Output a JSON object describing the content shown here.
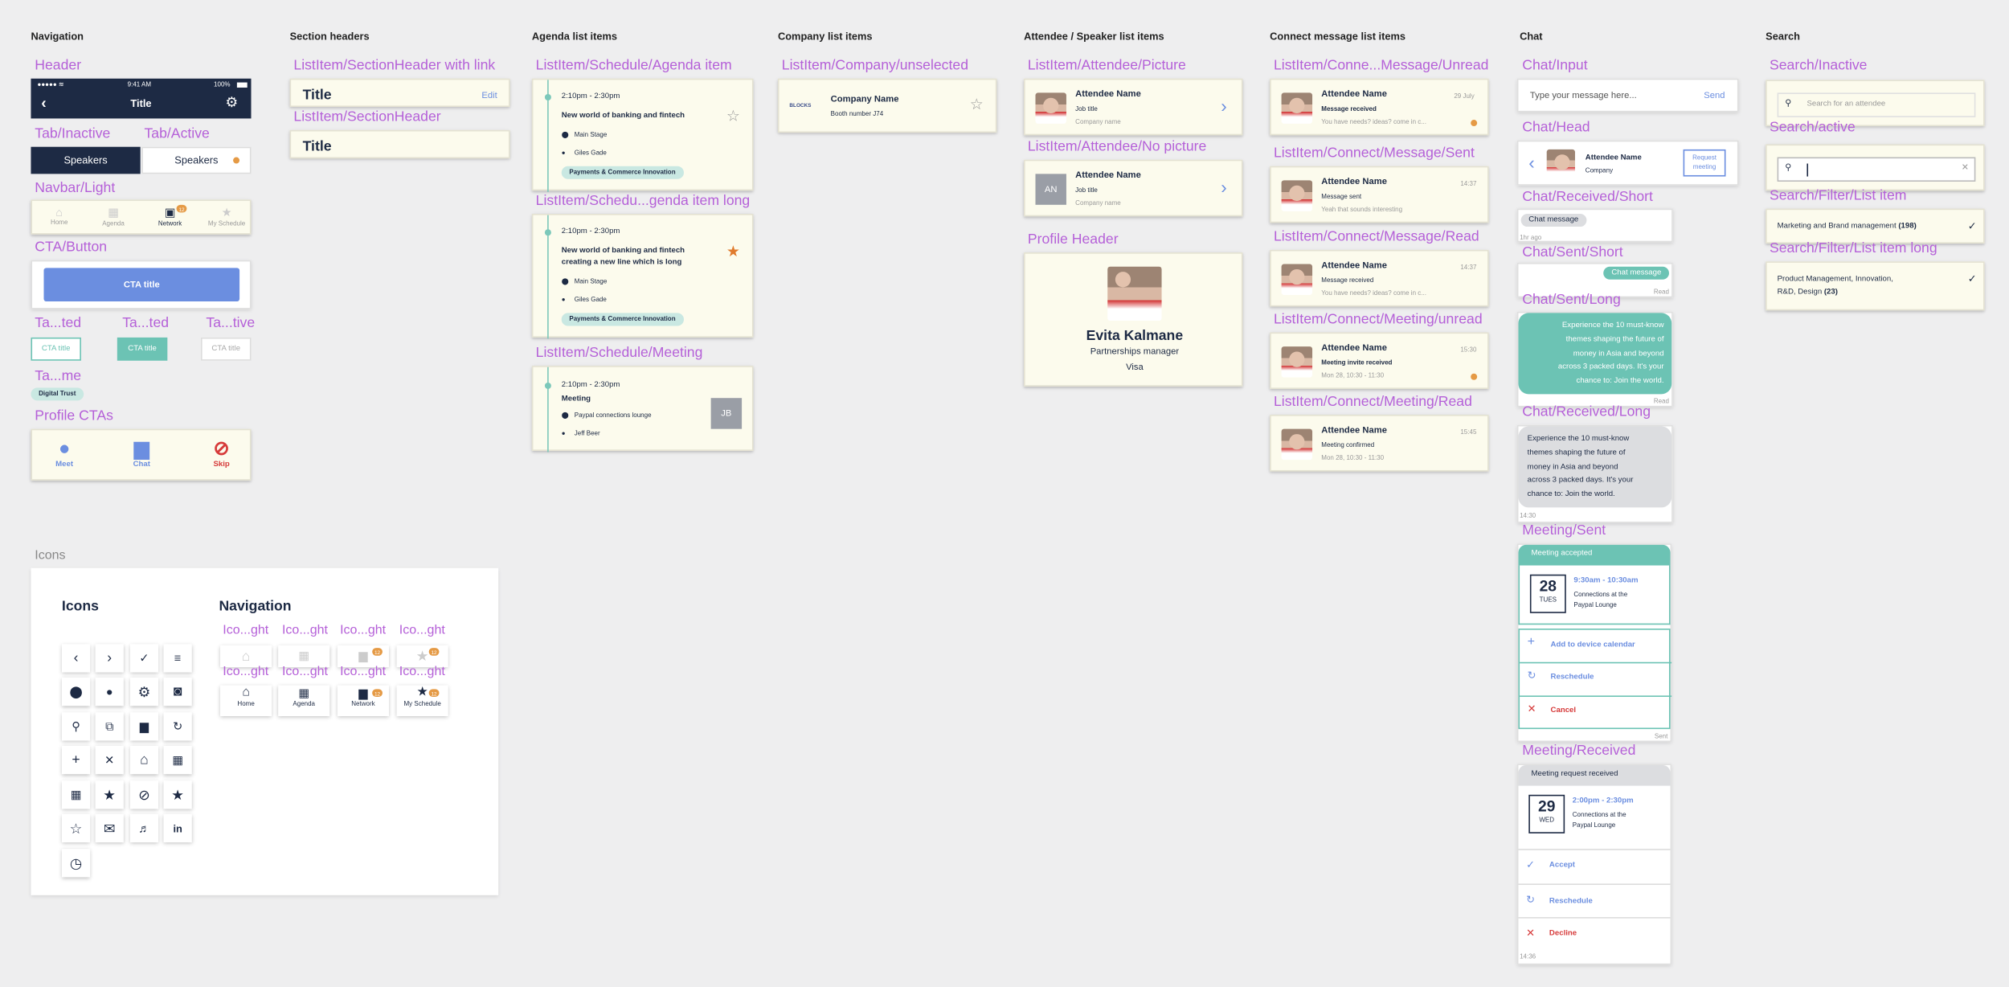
{
  "cols": {
    "navigation": "Navigation",
    "section_headers": "Section headers",
    "agenda": "Agenda list items",
    "company": "Company list items",
    "attendee": "Attendee / Speaker list items",
    "connect": "Connect message list items",
    "chat": "Chat",
    "search": "Search",
    "icons": "Icons"
  },
  "labels": {
    "header": "Header",
    "tab_inactive": "Tab/Inactive",
    "tab_active": "Tab/Active",
    "navbar": "Navbar/Light",
    "cta": "CTA/Button",
    "ta1": "Ta...ted",
    "ta2": "Ta...ted",
    "ta3": "Ta...tive",
    "tame": "Ta...me",
    "profile_ctas": "Profile CTAs",
    "sh_link": "ListItem/SectionHeader with link",
    "sh": "ListItem/SectionHeader",
    "agenda_item": "ListItem/Schedule/Agenda item",
    "agenda_long": "ListItem/Schedu...genda item long",
    "meeting": "ListItem/Schedule/Meeting",
    "company_unsel": "ListItem/Company/unselected",
    "att_pic": "ListItem/Attendee/Picture",
    "att_nopic": "ListItem/Attendee/No picture",
    "profile_header": "Profile Header",
    "c_unread": "ListItem/Conne...Message/Unread",
    "c_sent": "ListItem/Connect/Message/Sent",
    "c_read": "ListItem/Connect/Message/Read",
    "c_meet_unread": "ListItem/Connect/Meeting/unread",
    "c_meet_read": "ListItem/Connect/Meeting/Read",
    "chat_input": "Chat/Input",
    "chat_head": "Chat/Head",
    "recv_short": "Chat/Received/Short",
    "sent_short": "Chat/Sent/Short",
    "sent_long": "Chat/Sent/Long",
    "recv_long": "Chat/Received/Long",
    "meet_sent": "Meeting/Sent",
    "meet_recv": "Meeting/Received",
    "search_inactive": "Search/Inactive",
    "search_active": "Search/active",
    "filter_item": "Search/Filter/List item",
    "filter_long": "Search/Filter/List item long",
    "icons_label": "Icons",
    "icons_title": "Icons",
    "nav_title": "Navigation",
    "ico1": "Ico...ght",
    "ico2": "Ico...ght",
    "ico3": "Ico...ght",
    "ico4": "Ico...ght",
    "ico5": "Ico...ght",
    "ico6": "Ico...ght",
    "ico7": "Ico...ght",
    "ico8": "Ico...ght"
  },
  "status": {
    "time": "9:41 AM",
    "battery": "100%"
  },
  "header_title": "Title",
  "tabs": {
    "inactive": "Speakers",
    "active": "Speakers"
  },
  "navbar": {
    "home": "Home",
    "agenda": "Agenda",
    "network": "Network",
    "schedule": "My Schedule",
    "badge": "12"
  },
  "cta_title": "CTA title",
  "tag": "Digital Trust",
  "profile_ctas": {
    "meet": "Meet",
    "chat": "Chat",
    "skip": "Skip"
  },
  "sh": {
    "title": "Title",
    "edit": "Edit",
    "title2": "Title"
  },
  "agenda1": {
    "time": "2:10pm - 2:30pm",
    "title": "New world of banking and fintech",
    "loc": "Main Stage",
    "person": "Giles Gade",
    "chip": "Payments & Commerce Innovation"
  },
  "agenda2": {
    "time": "2:10pm - 2:30pm",
    "title1": "New world of banking and fintech",
    "title2": "creating a new line which is long",
    "loc": "Main Stage",
    "person": "Giles Gade",
    "chip": "Payments & Commerce Innovation"
  },
  "meet_item": {
    "time": "2:10pm - 2:30pm",
    "title": "Meeting",
    "loc": "Paypal connections lounge",
    "person": "Jeff Beer",
    "initials": "JB"
  },
  "company": {
    "name": "Company Name",
    "booth": "Booth number J74",
    "logo": "BLOCKS"
  },
  "att1": {
    "name": "Attendee Name",
    "job": "Job title",
    "company": "Company name"
  },
  "att2": {
    "name": "Attendee Name",
    "job": "Job title",
    "company": "Company name",
    "initials": "AN"
  },
  "profile": {
    "name": "Evita Kalmane",
    "role": "Partnerships manager",
    "company": "Visa"
  },
  "conn": [
    {
      "name": "Attendee Name",
      "time": "29 July",
      "line1": "Message received",
      "line2": "You have needs? ideas? come in c..."
    },
    {
      "name": "Attendee Name",
      "time": "14:37",
      "line1": "Message sent",
      "line2": "Yeah that sounds interesting"
    },
    {
      "name": "Attendee Name",
      "time": "14:37",
      "line1": "Message received",
      "line2": "You have needs? ideas? come in c..."
    },
    {
      "name": "Attendee Name",
      "time": "15:30",
      "line1": "Meeting invite received",
      "line2": "Mon 28, 10:30 - 11:30"
    },
    {
      "name": "Attendee Name",
      "time": "15:45",
      "line1": "Meeting confirmed",
      "line2": "Mon 28, 10:30 - 11:30"
    }
  ],
  "chat": {
    "placeholder": "Type your message here...",
    "send": "Send",
    "head_name": "Attendee Name",
    "head_company": "Company",
    "request1": "Request",
    "request2": "meeting",
    "short": "Chat message",
    "ago": "1hr ago",
    "sent_short": "Chat message",
    "read": "Read",
    "long": [
      "Experience the 10 must-know",
      "themes shaping the future of",
      "money in Asia and beyond",
      "across 3 packed days. It's your",
      "chance to: Join the world."
    ],
    "time_long": "14:30"
  },
  "meet_sent": {
    "banner": "Meeting accepted",
    "day": "28",
    "dow": "TUES",
    "time": "9:30am - 10:30am",
    "place1": "Connections at the",
    "place2": "Paypal Lounge",
    "add": "Add to device calendar",
    "resched": "Reschedule",
    "cancel": "Cancel",
    "sent": "Sent"
  },
  "meet_recv": {
    "banner": "Meeting request received",
    "day": "29",
    "dow": "WED",
    "time": "2:00pm - 2:30pm",
    "place1": "Connections at the",
    "place2": "Paypal Lounge",
    "accept": "Accept",
    "resched": "Reschedule",
    "decline": "Decline",
    "time_stamp": "14:36"
  },
  "search": {
    "placeholder": "Search for an attendee",
    "filter1": "Marketing and Brand management",
    "filter1_count": "(198)",
    "filter2a": "Product Management, Innovation,",
    "filter2b": "R&D, Design",
    "filter2_count": "(23)"
  },
  "colors": {
    "navy": "#1d2a44",
    "accent": "#6b8ee0",
    "teal": "#6cc3b4",
    "orange": "#e59a45",
    "pink": "#b560d8",
    "red": "#d63a3a"
  }
}
